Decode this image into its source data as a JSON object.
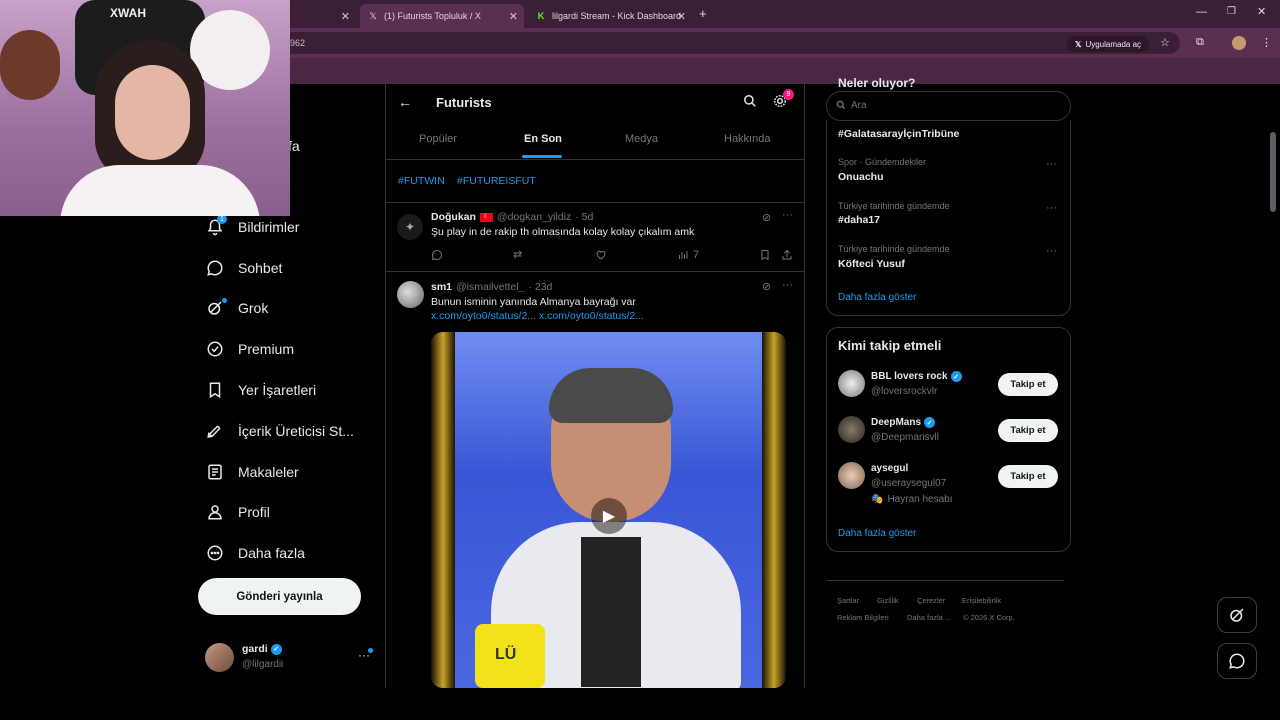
{
  "browser": {
    "tabs": [
      {
        "title": "(1) Futurists Topluluk / X",
        "favicon": "x-logo"
      },
      {
        "title": "lilgardi Stream - Kick Dashboard",
        "favicon": "kick-logo"
      }
    ],
    "new_tab": "+",
    "url_fragment": "962",
    "open_in_app": "Uygulamada aç"
  },
  "webcam": {
    "sign_text": "XWAH"
  },
  "nav": {
    "partial_item": "fa",
    "items": [
      {
        "label": "Bildirimler",
        "icon": "bell-icon"
      },
      {
        "label": "Sohbet",
        "icon": "chat-icon"
      },
      {
        "label": "Grok",
        "icon": "grok-icon"
      },
      {
        "label": "Premium",
        "icon": "premium-icon"
      },
      {
        "label": "Yer İşaretleri",
        "icon": "bookmark-icon"
      },
      {
        "label": "İçerik Üreticisi St...",
        "icon": "rocket-icon"
      },
      {
        "label": "Makaleler",
        "icon": "article-icon"
      },
      {
        "label": "Profil",
        "icon": "profile-icon"
      },
      {
        "label": "Daha fazla",
        "icon": "more-icon"
      }
    ],
    "notification_count": "1",
    "post_button": "Gönderi yayınla",
    "account": {
      "name": "gardi",
      "handle": "@lilgardii"
    }
  },
  "community": {
    "title": "Futurists",
    "settings_badge": "9",
    "tabs": [
      "Popüler",
      "En Son",
      "Medya",
      "Hakkında"
    ],
    "active_tab": "En Son",
    "hashtags": [
      "#FUTWIN",
      "#FUTUREISFUT"
    ]
  },
  "posts": [
    {
      "name": "Doğukan",
      "flag": "turkey-flag",
      "handle": "@dogkan_yildiz",
      "time": "· 5d",
      "text": "Şu play in de rakip th olmasında kolay kolay çıkalım amk",
      "views": "7"
    },
    {
      "name": "sm1",
      "handle": "@ismailvettel_",
      "time": "· 23d",
      "text": "Bunun isminin yanında Almanya bayrağı var",
      "links": "x.com/oyto0/status/2... x.com/oyto0/status/2...",
      "mug_text": "LÜ"
    }
  ],
  "right": {
    "search_placeholder": "Ara",
    "partial_header": "Neler oluyor?",
    "trends": [
      {
        "context": "",
        "title": "#GalatasarayİçinTribüne"
      },
      {
        "context": "Spor · Gündemdekiler",
        "title": "Onuachu"
      },
      {
        "context": "Türkiye tarihinde gündemde",
        "title": "#daha17"
      },
      {
        "context": "Türkiye tarihinde gündemde",
        "title": "Köfteci Yusuf"
      }
    ],
    "show_more": "Daha fazla göster",
    "who_to_follow_title": "Kimi takip etmeli",
    "follow_label": "Takip et",
    "suggestions": [
      {
        "name": "BBL lovers rock",
        "handle": "@loversrockvlr",
        "note": ""
      },
      {
        "name": "DeepMans",
        "handle": "@Deepmansvll",
        "note": ""
      },
      {
        "name": "aysegul",
        "handle": "@useraysegul07",
        "note": "Hayran hesabı"
      }
    ],
    "footer": [
      "Şartlar",
      "Gizlilik",
      "Çerezler",
      "Erişilebilirlik",
      "Reklam Bilgileri",
      "Daha fazla ...",
      "© 2026 X Corp."
    ]
  },
  "colors": {
    "accent": "#1d9bf0",
    "browser": "#5a2f52",
    "bg": "#000000"
  }
}
